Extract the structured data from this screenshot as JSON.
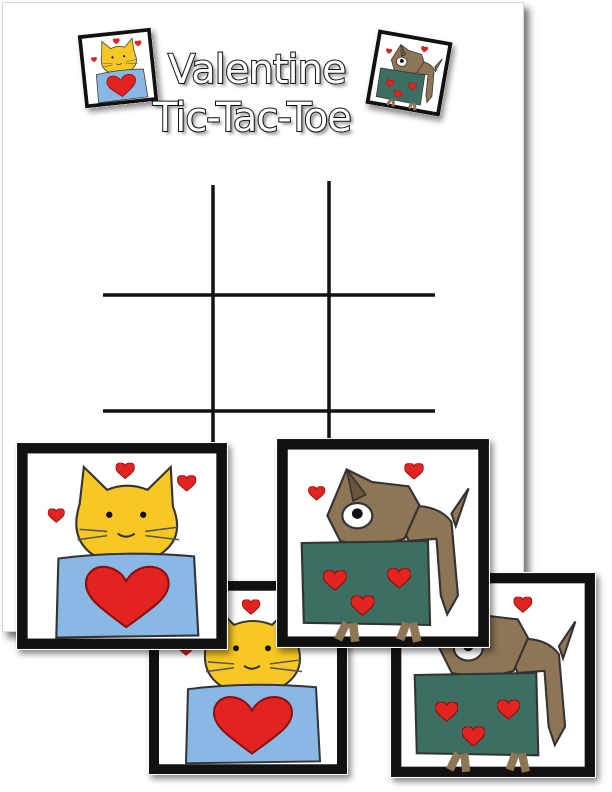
{
  "title": {
    "line1": "Valentine",
    "line2": "Tic-Tac-Toe"
  },
  "pieces": [
    {
      "name": "cat-card",
      "icon": "cat-icon",
      "size": "large"
    },
    {
      "name": "dog-card",
      "icon": "dog-icon",
      "size": "large"
    },
    {
      "name": "cat-card",
      "icon": "cat-icon",
      "size": "large"
    },
    {
      "name": "dog-card",
      "icon": "dog-icon",
      "size": "large"
    },
    {
      "name": "cat-logo-card",
      "icon": "cat-icon",
      "size": "small"
    },
    {
      "name": "dog-logo-card",
      "icon": "dog-icon",
      "size": "small"
    }
  ],
  "colors": {
    "heart": "#e3231f",
    "cat": "#f7c823",
    "cat_shirt": "#8ab8e4",
    "dog": "#8e7556",
    "dog_shirt": "#3d6e62",
    "grid": "#111111"
  }
}
